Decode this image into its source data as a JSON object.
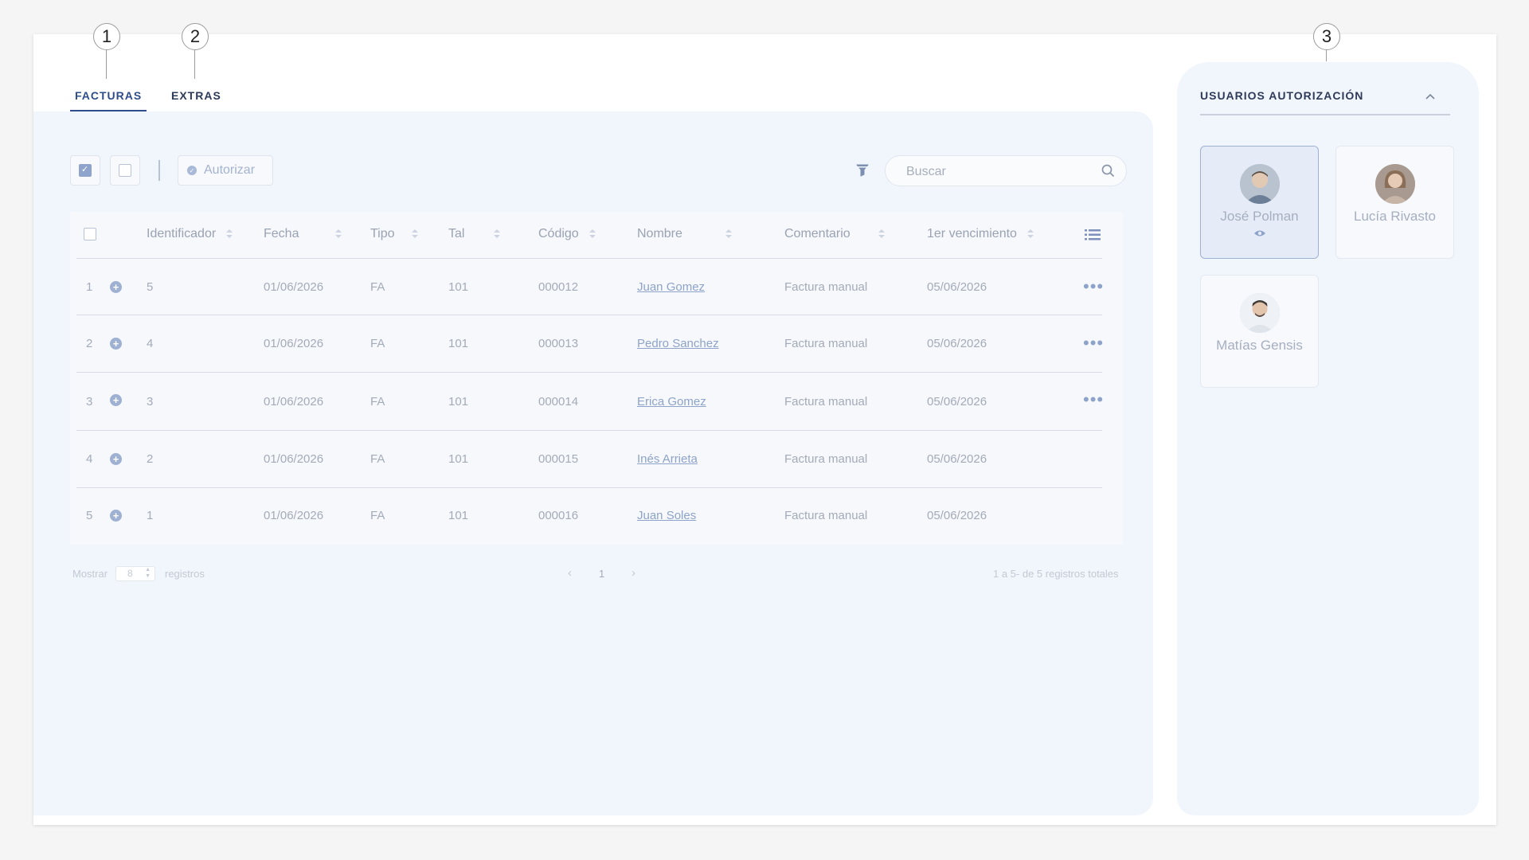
{
  "callouts": [
    "1",
    "2",
    "3"
  ],
  "tabs": [
    {
      "label": "FACTURAS",
      "active": true
    },
    {
      "label": "EXTRAS",
      "active": false
    }
  ],
  "toolbar": {
    "authorize_label": "Autorizar",
    "search_placeholder": "Buscar"
  },
  "table": {
    "headers": [
      "Identificador",
      "Fecha",
      "Tipo",
      "Tal",
      "Código",
      "Nombre",
      "Comentario",
      "1er vencimiento"
    ],
    "rows": [
      {
        "num": "1",
        "id": "5",
        "fecha": "01/06/2026",
        "tipo": "FA",
        "tal": "101",
        "codigo": "000012",
        "nombre": "Juan Gomez",
        "comentario": "Factura manual",
        "vencimiento": "05/06/2026",
        "has_menu": true
      },
      {
        "num": "2",
        "id": "4",
        "fecha": "01/06/2026",
        "tipo": "FA",
        "tal": "101",
        "codigo": "000013",
        "nombre": "Pedro Sanchez",
        "comentario": "Factura manual",
        "vencimiento": "05/06/2026",
        "has_menu": true
      },
      {
        "num": "3",
        "id": "3",
        "fecha": "01/06/2026",
        "tipo": "FA",
        "tal": "101",
        "codigo": "000014",
        "nombre": "Erica Gomez",
        "comentario": "Factura manual",
        "vencimiento": "05/06/2026",
        "has_menu": true
      },
      {
        "num": "4",
        "id": "2",
        "fecha": "01/06/2026",
        "tipo": "FA",
        "tal": "101",
        "codigo": "000015",
        "nombre": "Inés Arrieta",
        "comentario": "Factura manual",
        "vencimiento": "05/06/2026",
        "has_menu": false
      },
      {
        "num": "5",
        "id": "1",
        "fecha": "01/06/2026",
        "tipo": "FA",
        "tal": "101",
        "codigo": "000016",
        "nombre": "Juan Soles",
        "comentario": "Factura manual",
        "vencimiento": "05/06/2026",
        "has_menu": false
      }
    ]
  },
  "pagination": {
    "show_label": "Mostrar",
    "page_size": "8",
    "records_label": "registros",
    "current_page": "1",
    "summary": "1 a 5- de 5 registros totales"
  },
  "right_panel": {
    "title": "USUARIOS AUTORIZACIÓN",
    "users": [
      {
        "name": "José Polman",
        "selected": true
      },
      {
        "name": "Lucía Rivasto",
        "selected": false
      },
      {
        "name": "Matías Gensis",
        "selected": false
      }
    ]
  },
  "colors": {
    "accent": "#2e4d8a",
    "panel_bg": "#f1f5fc",
    "link": "#8ea3c9"
  }
}
